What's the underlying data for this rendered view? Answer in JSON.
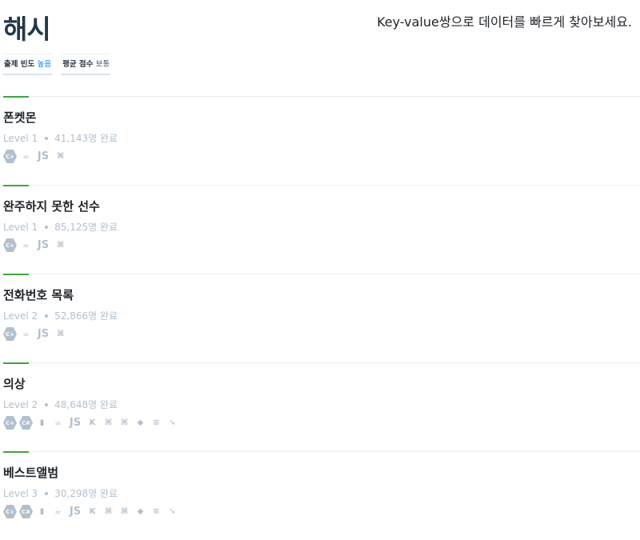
{
  "header": {
    "title": "해시",
    "description": "Key-value쌍으로 데이터를 빠르게 찾아보세요."
  },
  "tags": [
    {
      "label": "출제 빈도",
      "value": "높음"
    },
    {
      "label": "평균 점수",
      "value": "보통"
    }
  ],
  "problems": [
    {
      "name": "폰켓몬",
      "level": "Level 1",
      "solved": "41,143명 완료",
      "langs": [
        "c++",
        "java",
        "javascript",
        "python3"
      ]
    },
    {
      "name": "완주하지 못한 선수",
      "level": "Level 1",
      "solved": "85,125명 완료",
      "langs": [
        "c++",
        "java",
        "javascript",
        "python3"
      ]
    },
    {
      "name": "전화번호 목록",
      "level": "Level 2",
      "solved": "52,866명 완료",
      "langs": [
        "c++",
        "java",
        "javascript",
        "python3"
      ]
    },
    {
      "name": "의상",
      "level": "Level 2",
      "solved": "48,648명 완료",
      "langs": [
        "c++",
        "c#",
        "go",
        "java",
        "javascript",
        "kotlin",
        "python",
        "python3",
        "ruby",
        "scala",
        "swift"
      ]
    },
    {
      "name": "베스트앨범",
      "level": "Level 3",
      "solved": "30,298명 완료",
      "langs": [
        "c++",
        "c#",
        "go",
        "java",
        "javascript",
        "kotlin",
        "python",
        "python3",
        "ruby",
        "scala",
        "swift"
      ]
    }
  ],
  "icons": {
    "c++": "C+",
    "c#": "C#",
    "go": "▮",
    "java": "☕",
    "javascript": "JS",
    "kotlin": "K",
    "python": "⌘",
    "python3": "⌘",
    "ruby": "◆",
    "scala": "≡",
    "swift": "➘"
  },
  "colors": {
    "accent": "#44a340",
    "link": "#0078ff",
    "muted": "#b2c0cc"
  }
}
